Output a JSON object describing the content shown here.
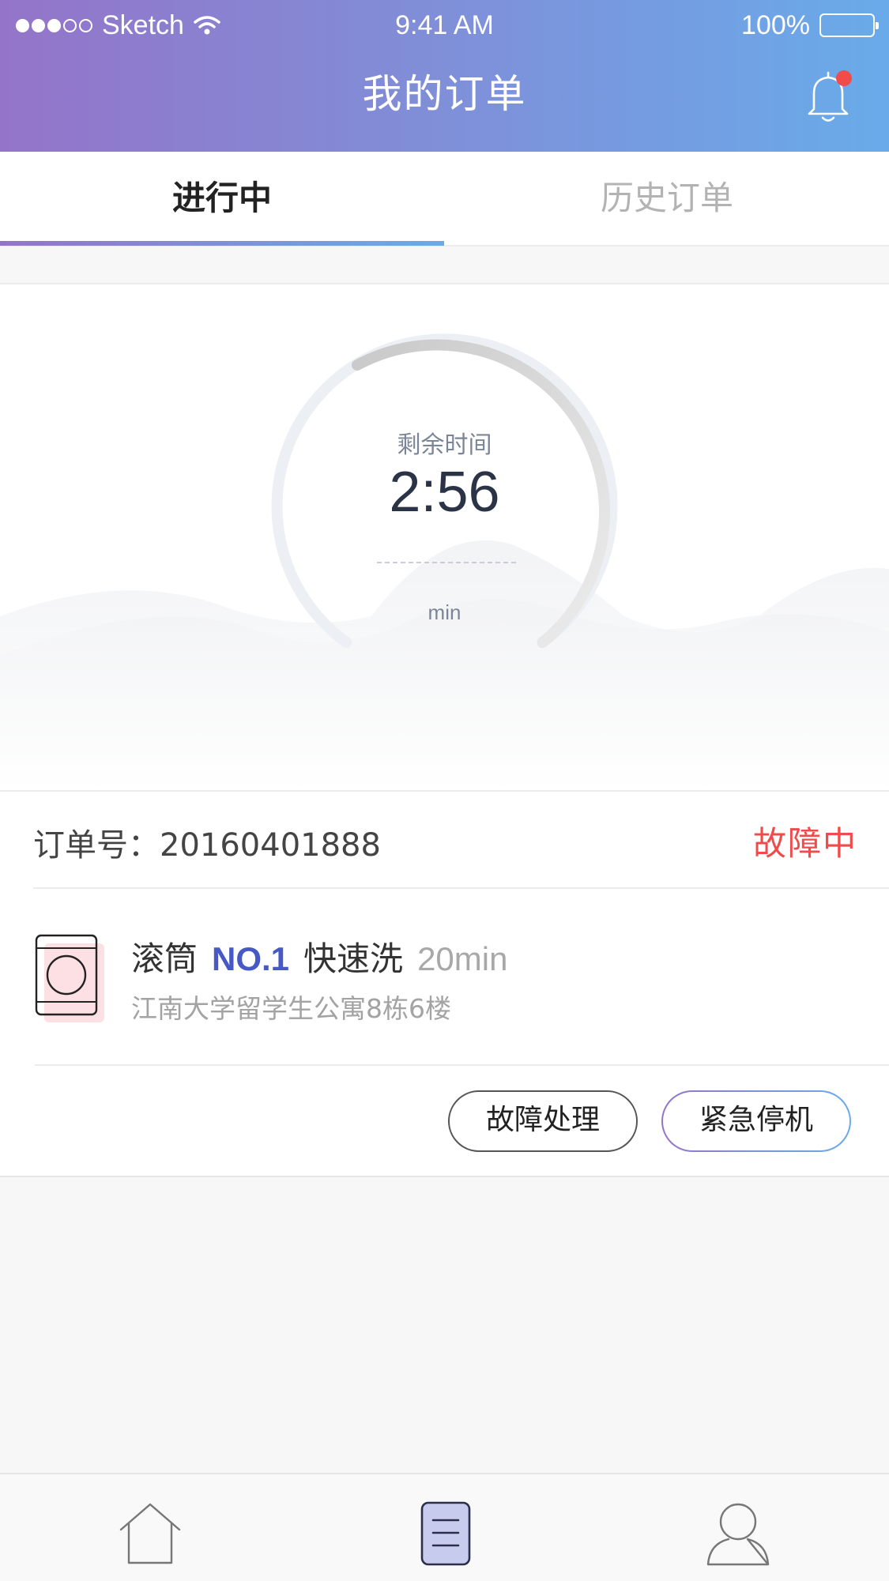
{
  "status_bar": {
    "carrier": "Sketch",
    "time": "9:41 AM",
    "battery": "100%"
  },
  "header": {
    "title": "我的订单",
    "notification_icon": "bell-icon",
    "has_unread": true
  },
  "tabs": [
    {
      "label": "进行中",
      "active": true
    },
    {
      "label": "历史订单",
      "active": false
    }
  ],
  "timer": {
    "label": "剩余时间",
    "value": "2:56",
    "unit": "min"
  },
  "order": {
    "number_label": "订单号：",
    "number": "20160401888",
    "status": "故障中",
    "machine_type": "滚筒",
    "machine_number": "NO.1",
    "program": "快速洗",
    "duration": "20min",
    "address": "江南大学留学生公寓8栋6楼",
    "actions": {
      "fault": "故障处理",
      "stop": "紧急停机"
    }
  },
  "tabbar": [
    {
      "icon": "home-icon",
      "active": false
    },
    {
      "icon": "orders-icon",
      "active": true
    },
    {
      "icon": "profile-icon",
      "active": false
    }
  ],
  "colors": {
    "header_gradient_start": "#9474c9",
    "header_gradient_end": "#69abea",
    "status_error": "#f04a4a",
    "machine_number": "#4759c4",
    "timer_text": "#2b3446"
  }
}
